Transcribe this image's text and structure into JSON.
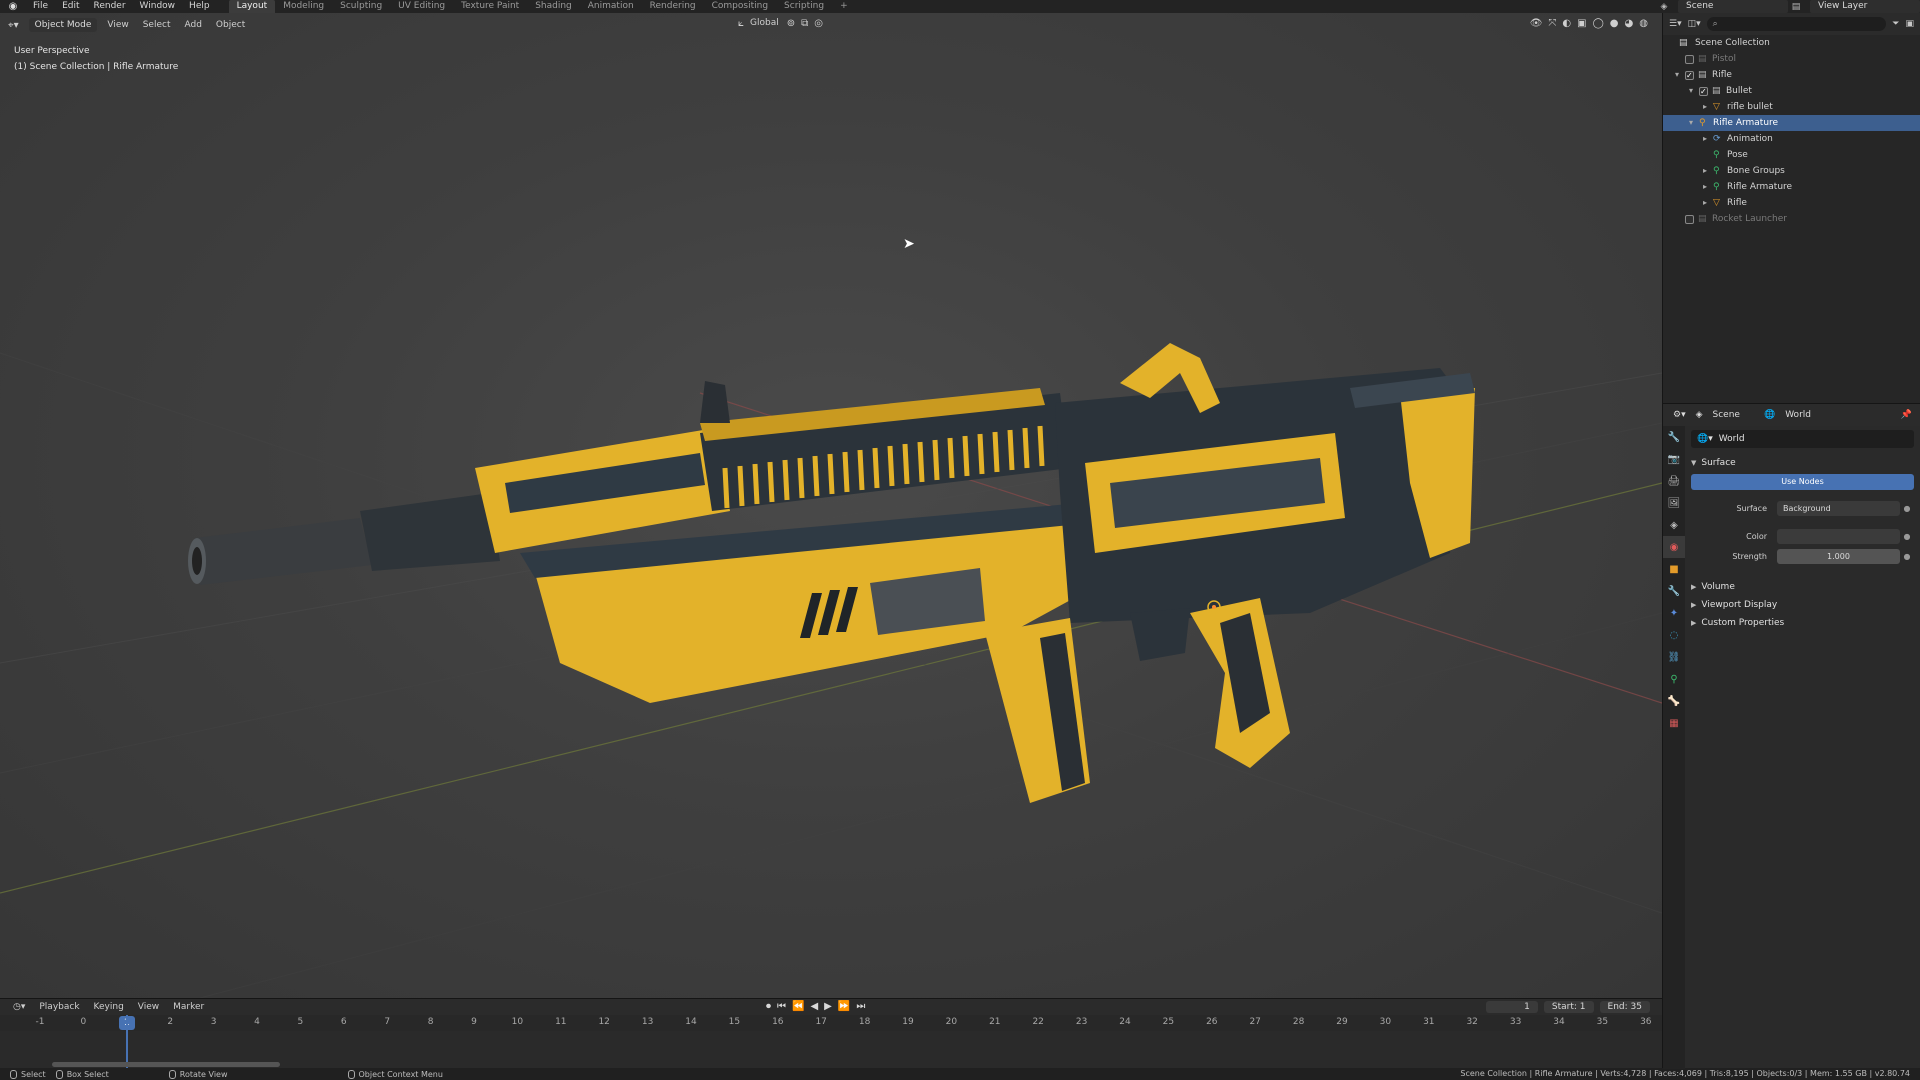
{
  "topbar": {
    "menus": [
      "File",
      "Edit",
      "Render",
      "Window",
      "Help"
    ],
    "workspaces": [
      "Layout",
      "Modeling",
      "Sculpting",
      "UV Editing",
      "Texture Paint",
      "Shading",
      "Animation",
      "Rendering",
      "Compositing",
      "Scripting"
    ],
    "active_workspace": "Layout",
    "add_tab": "+",
    "scene": "Scene",
    "view_layer": "View Layer"
  },
  "viewport": {
    "mode": "Object Mode",
    "menus": [
      "View",
      "Select",
      "Add",
      "Object"
    ],
    "orientation": "Global",
    "perspective": "User Perspective",
    "collection_path": "(1) Scene Collection | Rifle Armature"
  },
  "outliner": {
    "root": "Scene Collection",
    "items": [
      {
        "label": "Pistol",
        "level": 0,
        "dim": true,
        "checked": false,
        "icon": "collection-icon",
        "arrow": ""
      },
      {
        "label": "Rifle",
        "level": 0,
        "dim": false,
        "checked": true,
        "icon": "collection-icon",
        "arrow": "▾"
      },
      {
        "label": "Bullet",
        "level": 1,
        "dim": false,
        "checked": true,
        "icon": "collection-icon",
        "arrow": "▾"
      },
      {
        "label": "rifle bullet",
        "level": 2,
        "dim": false,
        "checked": null,
        "icon": "mesh-icon",
        "arrow": "▸"
      },
      {
        "label": "Rifle Armature",
        "level": 1,
        "dim": false,
        "checked": null,
        "icon": "armature-icon",
        "arrow": "▾",
        "selected": true
      },
      {
        "label": "Animation",
        "level": 2,
        "dim": false,
        "checked": null,
        "icon": "action-icon",
        "arrow": "▸"
      },
      {
        "label": "Pose",
        "level": 2,
        "dim": false,
        "checked": null,
        "icon": "pose-icon",
        "arrow": ""
      },
      {
        "label": "Bone Groups",
        "level": 2,
        "dim": false,
        "checked": null,
        "icon": "bone-group-icon",
        "arrow": "▸"
      },
      {
        "label": "Rifle Armature",
        "level": 2,
        "dim": false,
        "checked": null,
        "icon": "armature-data-icon",
        "arrow": "▸"
      },
      {
        "label": "Rifle",
        "level": 2,
        "dim": false,
        "checked": null,
        "icon": "mesh-icon",
        "arrow": "▸"
      },
      {
        "label": "Rocket Launcher",
        "level": 0,
        "dim": true,
        "checked": false,
        "icon": "collection-icon",
        "arrow": ""
      }
    ]
  },
  "properties": {
    "breadcrumb_scene": "Scene",
    "breadcrumb_world": "World",
    "world_name": "World",
    "surface_panel": "Surface",
    "use_nodes": "Use Nodes",
    "surface_label": "Surface",
    "surface_value": "Background",
    "color_label": "Color",
    "strength_label": "Strength",
    "strength_value": "1.000",
    "collapsed_panels": [
      "Volume",
      "Viewport Display",
      "Custom Properties"
    ]
  },
  "timeline": {
    "menus": [
      "Playback",
      "Keying",
      "View",
      "Marker"
    ],
    "current_frame": "1",
    "start_label": "Start:",
    "start_value": "1",
    "end_label": "End:",
    "end_value": "35",
    "ticks": [
      "-1",
      "0",
      "1",
      "2",
      "3",
      "4",
      "5",
      "6",
      "7",
      "8",
      "9",
      "10",
      "11",
      "12",
      "13",
      "14",
      "15",
      "16",
      "17",
      "18",
      "19",
      "20",
      "21",
      "22",
      "23",
      "24",
      "25",
      "26",
      "27",
      "28",
      "29",
      "30",
      "31",
      "32",
      "33",
      "34",
      "35",
      "36"
    ]
  },
  "status": {
    "select": "Select",
    "box_select": "Box Select",
    "rotate_view": "Rotate View",
    "context_menu": "Object Context Menu",
    "stats": "Scene Collection | Rifle Armature | Verts:4,728 | Faces:4,069 | Tris:8,195 | Objects:0/3 | Mem: 1.55 GB | v2.80.74"
  },
  "colors": {
    "accent": "#4772b3",
    "gun_yellow": "#e3b22a",
    "gun_steel": "#2f3a44"
  }
}
